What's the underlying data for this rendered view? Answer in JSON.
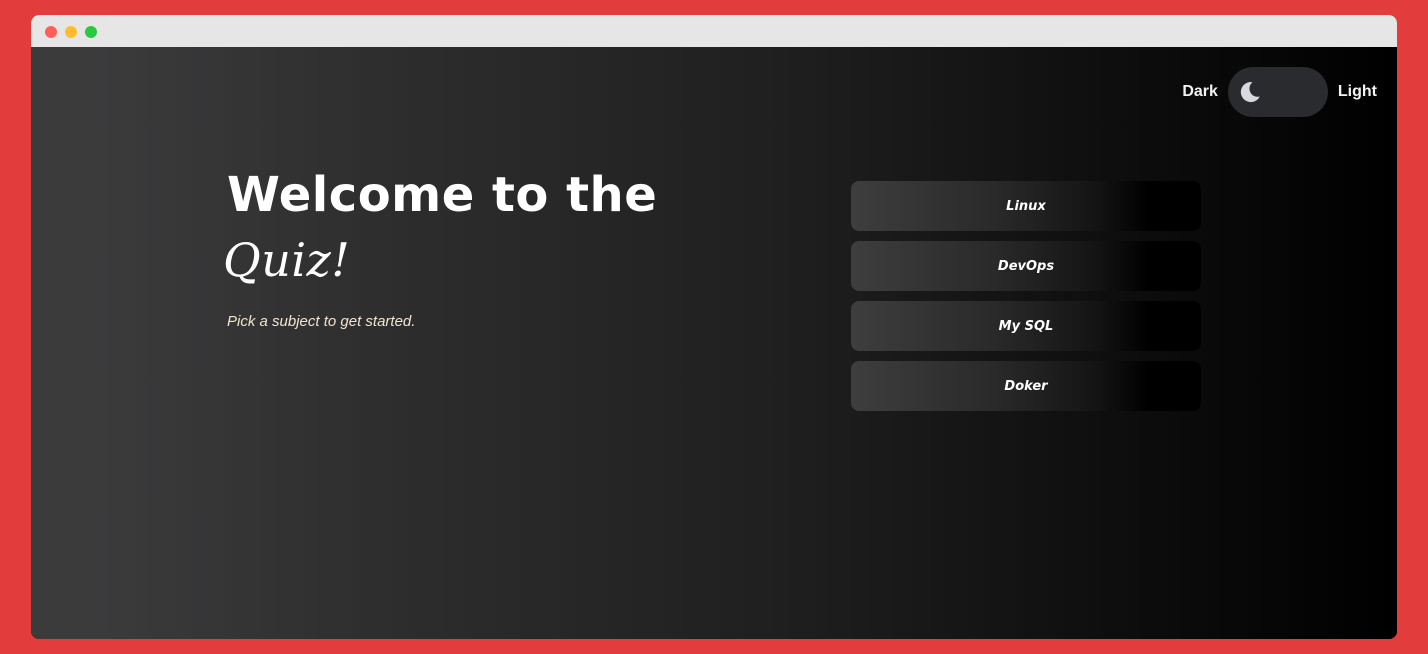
{
  "theme_toggle": {
    "dark_label": "Dark",
    "light_label": "Light",
    "icon": "moon-icon",
    "state": "dark"
  },
  "hero": {
    "title_line1": "Welcome to the",
    "title_line2": "Quiz!",
    "subtitle": "Pick a subject to get started."
  },
  "subjects": [
    {
      "label": "Linux"
    },
    {
      "label": "DevOps"
    },
    {
      "label": "My SQL"
    },
    {
      "label": "Doker"
    }
  ],
  "colors": {
    "frame": "#e23c3c",
    "text": "#ffffff",
    "subtitle": "#f3e3cf",
    "toggle_track": "#2a2b2e",
    "moon": "#d6d9df"
  }
}
